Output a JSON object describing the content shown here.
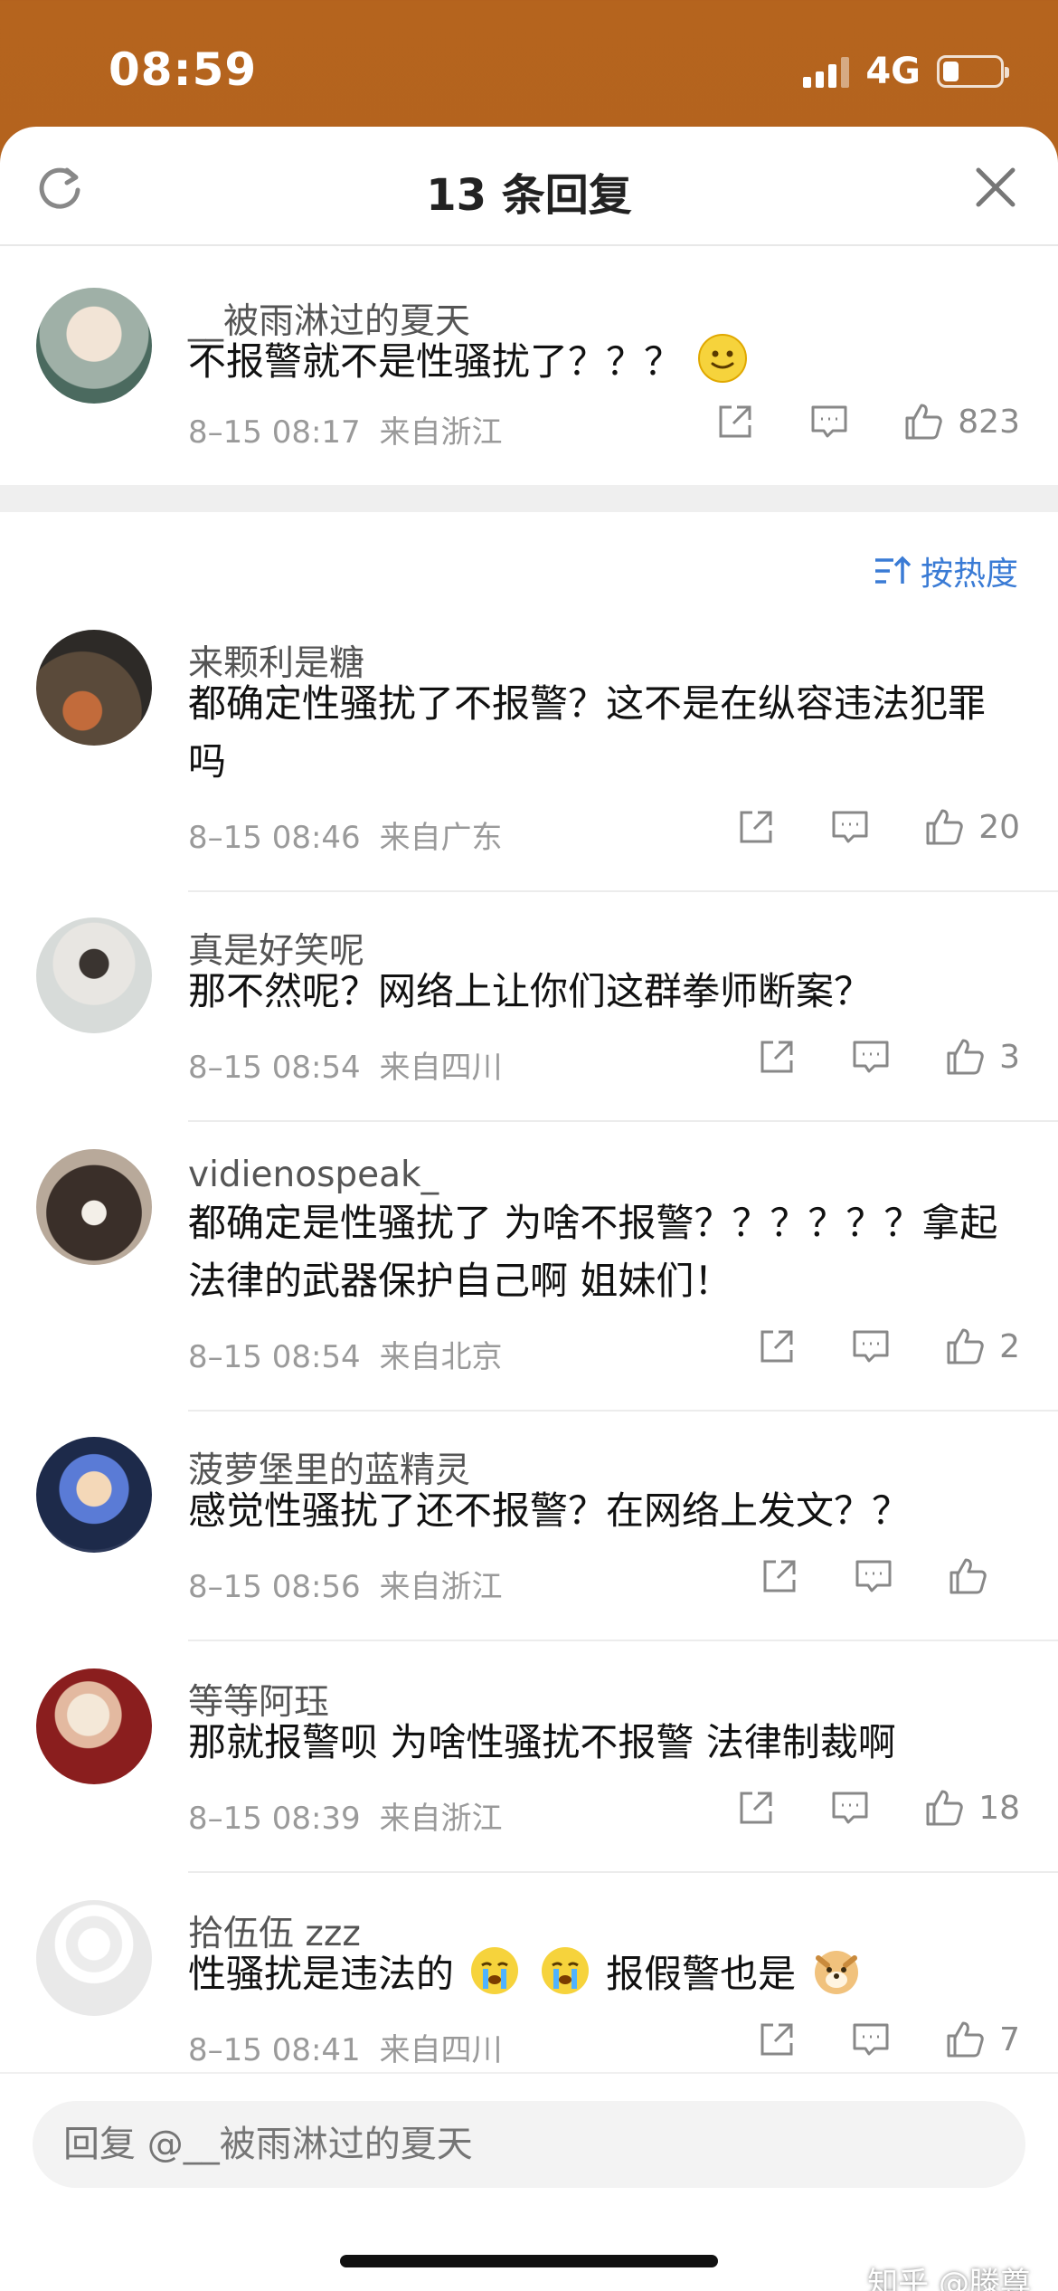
{
  "status": {
    "time": "08:59",
    "network": "4G"
  },
  "header": {
    "title": "13 条回复"
  },
  "top_comment": {
    "name": "__被雨淋过的夏天",
    "text": "不报警就不是性骚扰了？？？",
    "date": "8–15 08:17",
    "location": "来自浙江",
    "likes": "823"
  },
  "sort": {
    "label": "按热度"
  },
  "replies": [
    {
      "name": "来颗利是糖",
      "text": "都确定性骚扰了不报警？这不是在纵容违法犯罪吗",
      "date": "8–15 08:46",
      "location": "来自广东",
      "likes": "20"
    },
    {
      "name": "真是好笑呢",
      "text": "那不然呢？网络上让你们这群拳师断案？",
      "date": "8–15 08:54",
      "location": "来自四川",
      "likes": "3"
    },
    {
      "name": "vidienospeak_",
      "text": "都确定是性骚扰了 为啥不报警？？？？？？拿起法律的武器保护自己啊 姐妹们！",
      "date": "8–15 08:54",
      "location": "来自北京",
      "likes": "2"
    },
    {
      "name": "菠萝堡里的蓝精灵",
      "text": "感觉性骚扰了还不报警？在网络上发文？？",
      "date": "8–15 08:56",
      "location": "来自浙江",
      "likes": ""
    },
    {
      "name": "等等阿珏",
      "text": "那就报警呗 为啥性骚扰不报警 法律制裁啊",
      "date": "8–15 08:39",
      "location": "来自浙江",
      "likes": "18"
    },
    {
      "name": "拾伍伍 zzz",
      "text_a": "性骚扰是违法的",
      "text_b": "报假警也是",
      "date": "8–15 08:41",
      "location": "来自四川",
      "likes": "7"
    }
  ],
  "input": {
    "placeholder": "回复 @__被雨淋过的夏天"
  },
  "watermark": "知乎 @滕尊",
  "icons": [
    "refresh-icon",
    "close-icon",
    "share-icon",
    "comment-icon",
    "like-icon",
    "sort-icon"
  ],
  "colors": {
    "accent": "#3a7bd5",
    "header_bg": "#b5641e"
  }
}
